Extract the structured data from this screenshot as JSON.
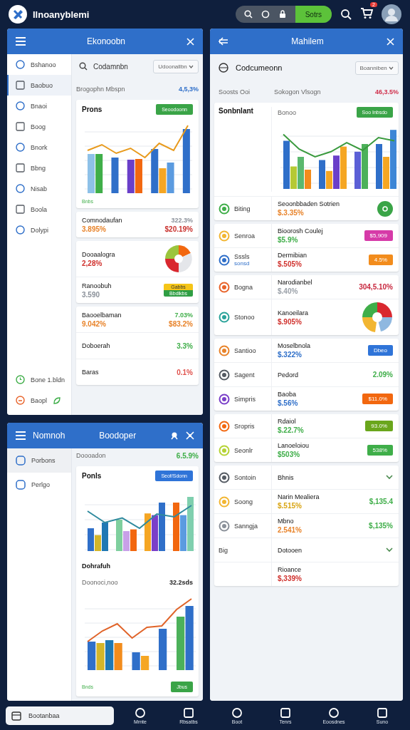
{
  "header": {
    "app_title": "Ilnoanyblemi",
    "action_button": "Sotrs",
    "cart_badge": "2"
  },
  "economy_panel": {
    "title": "Ekonoobn",
    "sidebar": [
      {
        "label": "Bshanoo",
        "selected": false
      },
      {
        "label": "Baobuo",
        "selected": true
      },
      {
        "label": "Bnaoi",
        "selected": false
      },
      {
        "label": "Boog",
        "selected": false
      },
      {
        "label": "Bnork",
        "selected": false
      },
      {
        "label": "Bbng",
        "selected": false
      },
      {
        "label": "Nisab",
        "selected": false
      },
      {
        "label": "Boola",
        "selected": false
      },
      {
        "label": "Dolypi",
        "selected": false
      }
    ],
    "sidebar_footer": [
      "Bone 1.bldn",
      "Baopl"
    ],
    "search": {
      "value": "Codamnbn"
    },
    "dropdown": "Udoonallbn",
    "summary": {
      "label": "Brogophn Mbspn",
      "value": "4,5,3%"
    },
    "chart_card": {
      "title": "Prons",
      "button": "Seoodoonn",
      "legend": "Bnbs"
    },
    "card_groups": [
      [
        {
          "kind": "values",
          "title": "Comnodaufan",
          "sub": {
            "text": "3.895%",
            "color": "#e8832a"
          },
          "right": [
            {
              "text": "322.3%",
              "color": "#8a9099"
            },
            {
              "text": "$20.19%",
              "color": "#c9302c"
            }
          ]
        }
      ],
      [
        {
          "kind": "pie",
          "title": "Dooaalogra",
          "sub": {
            "text": "2,28%",
            "color": "#d0312d"
          }
        },
        {
          "kind": "stacked_badge",
          "title": "Ranoobuh",
          "sub": {
            "text": "3.590",
            "color": "#8a9099"
          },
          "badge": [
            "Gabbs",
            "Bbdlkbs"
          ]
        }
      ],
      [
        {
          "kind": "values",
          "title": "Baooelbaman",
          "sub": {
            "text": "9.042%",
            "color": "#e8832a"
          },
          "right": [
            {
              "text": "7.03%",
              "color": "#3fae49"
            },
            {
              "text": "$83.2%",
              "color": "#e8832a"
            }
          ]
        },
        {
          "kind": "values",
          "title": "Doboerah",
          "right": [
            {
              "text": "3.3%",
              "color": "#3fae49"
            }
          ]
        },
        {
          "kind": "values",
          "title": "Baras",
          "right": [
            {
              "text": "0.1%",
              "color": "#e0524d"
            }
          ]
        }
      ]
    ]
  },
  "notes_panel": {
    "title": "Nomnoh",
    "subtitle": "Boodoper",
    "sidebar": [
      {
        "label": "Porbons",
        "selected": true
      },
      {
        "label": "Perlgo",
        "selected": false
      }
    ],
    "summary": {
      "label": "Doooadon",
      "value": "6.5.9%"
    },
    "chart_card": {
      "title": "Ponls",
      "button": "Seof/Sdonn",
      "section_title": "Dohrafuh",
      "section_label": "Doonoci,noo",
      "section_value": "32.2sds",
      "legend": "Bnds",
      "footer_button": "Jbus"
    }
  },
  "main_panel": {
    "title": "Mahilem",
    "tab": "Codcumeonn",
    "dropdown": "Boanniben",
    "summary": {
      "side_label": "Soosts Ooi",
      "label": "Sokogon Vlsogn",
      "value": "46,3.5%"
    },
    "chart_card": {
      "title": "Sonbnlant",
      "subtitle": "Bonoo",
      "button": "Soo Inbsdo"
    },
    "groups": [
      [
        {
          "kind": "round_button",
          "label": "Biting",
          "color": "#3fae49",
          "title": "Seoonbbaden Sotrien",
          "sub": {
            "text": "$.3.35%",
            "color": "#e8832a"
          }
        }
      ],
      [
        {
          "kind": "badge",
          "label": "Senroa",
          "color": "#f2b632",
          "title": "Bioorosh Coulej",
          "sub": {
            "text": "$5.9%",
            "color": "#3fae49"
          },
          "trailing": {
            "text": "$5,909",
            "color": "#d63aa8"
          }
        },
        {
          "kind": "badge",
          "label": "Sssls",
          "label_note": "sonsd",
          "color": "#2f6fc9",
          "title": "Dermibian",
          "sub": {
            "text": "$.505%",
            "color": "#d0312d"
          },
          "trailing": {
            "text": "4.5%",
            "color": "#f28c1c"
          }
        }
      ],
      [
        {
          "kind": "value",
          "label": "Bogna",
          "color": "#e8632a",
          "title": "Narodianbel",
          "sub": {
            "text": "$.40%",
            "color": "#9aa0a8"
          },
          "trailing": {
            "text": "304,5.10%",
            "color": "#c8283f"
          }
        },
        {
          "kind": "pie",
          "label": "Stonoo",
          "color": "#2aa39a",
          "title": "Kanoeilara",
          "sub": {
            "text": "$.905%",
            "color": "#d0312d"
          }
        }
      ],
      [
        {
          "kind": "badge",
          "label": "Santioo",
          "color": "#e8832a",
          "title": "Moselbnola",
          "sub": {
            "text": "$.322%",
            "color": "#2f6fc9"
          },
          "trailing": {
            "text": "Dbeo",
            "color": "#2f74d8"
          }
        },
        {
          "kind": "value",
          "label": "Sagent",
          "color": "#555b63",
          "title": "Pedord",
          "trailing": {
            "text": "2.09%",
            "color": "#3fae49"
          }
        },
        {
          "kind": "badge",
          "label": "Simpris",
          "color": "#7a3fc9",
          "title": "Baoba",
          "sub": {
            "text": "$.56%",
            "color": "#2f6fc9"
          },
          "trailing": {
            "text": "$11.0%",
            "color": "#f2670f"
          }
        }
      ],
      [
        {
          "kind": "badge",
          "label": "Sropris",
          "color": "#f2670f",
          "title": "Rdaiol",
          "sub": {
            "text": "$.22.7%",
            "color": "#3fae49"
          },
          "trailing": {
            "text": "93.0%",
            "color": "#6aa61c"
          }
        },
        {
          "kind": "badge",
          "label": "Seonlr",
          "color": "#b5d334",
          "title": "Lanoeloiou",
          "sub": {
            "text": "$503%",
            "color": "#3fae49"
          },
          "trailing": {
            "text": "538%",
            "color": "#3fae49"
          }
        }
      ],
      [
        {
          "kind": "chevron",
          "label": "Sontoin",
          "color": "#555b63",
          "title": "Bhnis"
        },
        {
          "kind": "value",
          "label": "Soong",
          "color": "#f2b632",
          "title": "Narin Mealiera",
          "sub": {
            "text": "$.515%",
            "color": "#d9a514"
          },
          "trailing": {
            "text": "$,135.4",
            "color": "#3fae49"
          }
        },
        {
          "kind": "value",
          "label": "Sanngja",
          "color": "#8a9099",
          "title": "Mbno",
          "sub": {
            "text": "2.541%",
            "color": "#e8832a"
          },
          "trailing": {
            "text": "$,135%",
            "color": "#3fae49"
          }
        },
        {
          "kind": "chevron",
          "label": "Big",
          "title": "Dotooen"
        },
        {
          "kind": "plain",
          "title": "Rioance",
          "sub": {
            "text": "$,339%",
            "color": "#d0312d"
          }
        }
      ]
    ]
  },
  "bottom_nav": {
    "search": {
      "value": "Bootanbaa"
    },
    "items": [
      {
        "label": "Mrnte"
      },
      {
        "label": "Rbsatbs"
      },
      {
        "label": "Boot"
      },
      {
        "label": "Tenrs"
      },
      {
        "label": "Eoosdnes"
      },
      {
        "label": "Suno"
      }
    ]
  }
}
